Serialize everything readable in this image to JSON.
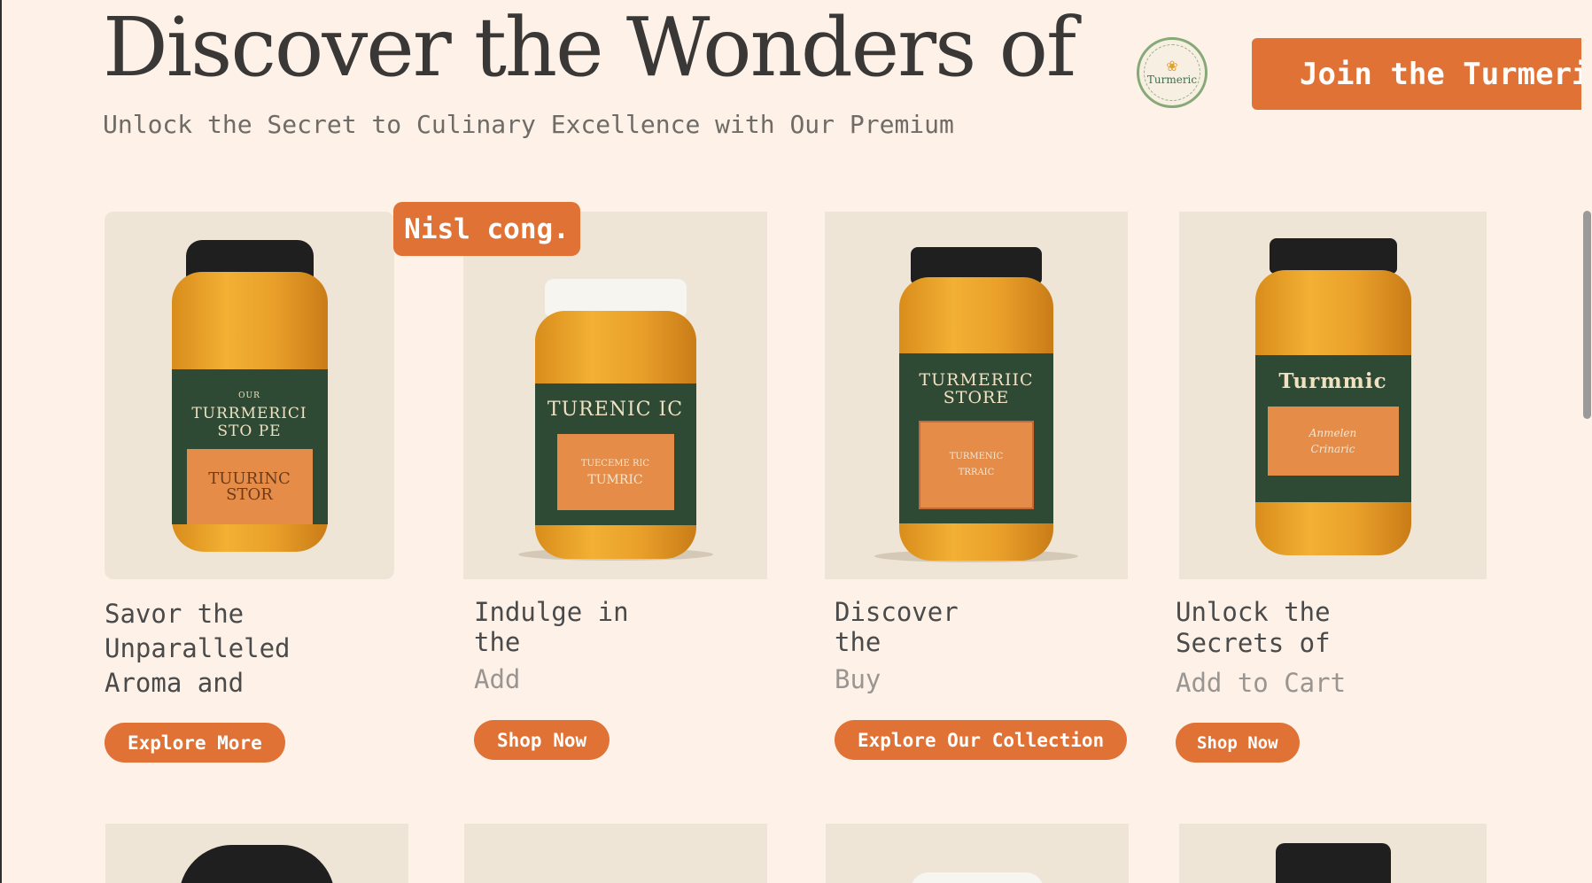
{
  "hero": {
    "title": "Discover the Wonders of",
    "subtitle": "Unlock the Secret to Culinary Excellence with Our Premium",
    "cta_label": "Join the Turmeric",
    "logo_text": "Turmeric"
  },
  "badge": {
    "label": "Nisl cong."
  },
  "products": [
    {
      "title_lines": [
        "Savor the",
        "Unparalleled",
        "Aroma and"
      ],
      "subtitle": "",
      "button": "Explore More",
      "jar_label": [
        "OUR",
        "TURRMERICI",
        "STO PE"
      ],
      "jar_panel": [
        "TUURINC",
        "STOR"
      ]
    },
    {
      "title_lines": [
        "Indulge in",
        "the"
      ],
      "subtitle": "Add",
      "button": "Shop Now",
      "jar_label": [
        "TURENIC IC"
      ],
      "jar_panel": [
        "TUECEME RIC",
        "TUMRIC"
      ]
    },
    {
      "title_lines": [
        "Discover",
        "the"
      ],
      "subtitle": "Buy",
      "button": "Explore Our Collection",
      "jar_label": [
        "TURMERIIC",
        "STORE"
      ],
      "jar_panel": [
        "TURMENIC",
        "TRRAIC"
      ]
    },
    {
      "title_lines": [
        "Unlock the",
        "Secrets of"
      ],
      "subtitle": "Add to Cart",
      "button": "Shop Now",
      "jar_label": [
        "Turmmic"
      ],
      "jar_panel": [
        "Anmelen",
        "Crinaric"
      ]
    }
  ],
  "colors": {
    "background": "#fdf1e8",
    "accent": "#e07235",
    "card_bg": "#efe5d6",
    "label_green": "#2e4a35"
  }
}
